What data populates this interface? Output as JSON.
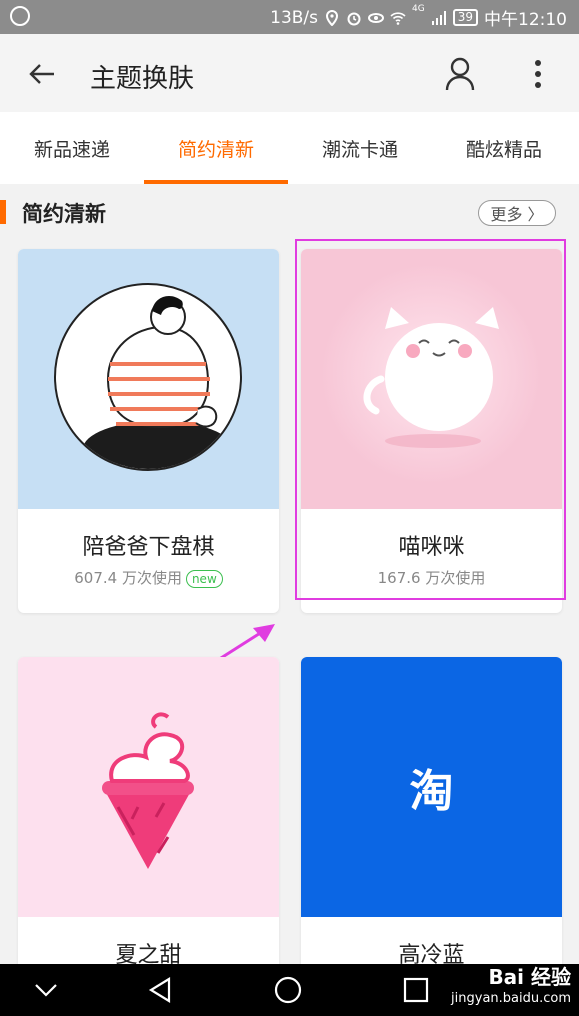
{
  "status_bar": {
    "network_speed": "13B/s",
    "signal_label": "4G",
    "battery": "39",
    "time": "中午12:10"
  },
  "header": {
    "title": "主题换肤",
    "back_icon": "back-arrow-icon",
    "user_icon": "user-icon",
    "more_icon": "more-vertical-icon"
  },
  "tabs": [
    {
      "label": "新品速递",
      "active": false
    },
    {
      "label": "简约清新",
      "active": true
    },
    {
      "label": "潮流卡通",
      "active": false
    },
    {
      "label": "酷炫精品",
      "active": false
    }
  ],
  "section": {
    "title": "简约清新",
    "more_label": "更多 〉"
  },
  "cards": [
    {
      "name": "陪爸爸下盘棋",
      "usage": "607.4 万次使用",
      "badge": "new",
      "bg": "#c6dff4"
    },
    {
      "name": "喵咪咪",
      "usage": "167.6 万次使用",
      "bg": "#f7c6d6"
    },
    {
      "name": "夏之甜",
      "bg": "#fde0ee"
    },
    {
      "name": "高冷蓝",
      "logo_text": "淘",
      "bg": "#0b66e4"
    }
  ],
  "colors": {
    "accent": "#ff6a00",
    "highlight": "#e03ce0",
    "badge_green": "#3bbf4f"
  },
  "watermark": {
    "main": "Bai 经验",
    "sub": "jingyan.baidu.com"
  }
}
